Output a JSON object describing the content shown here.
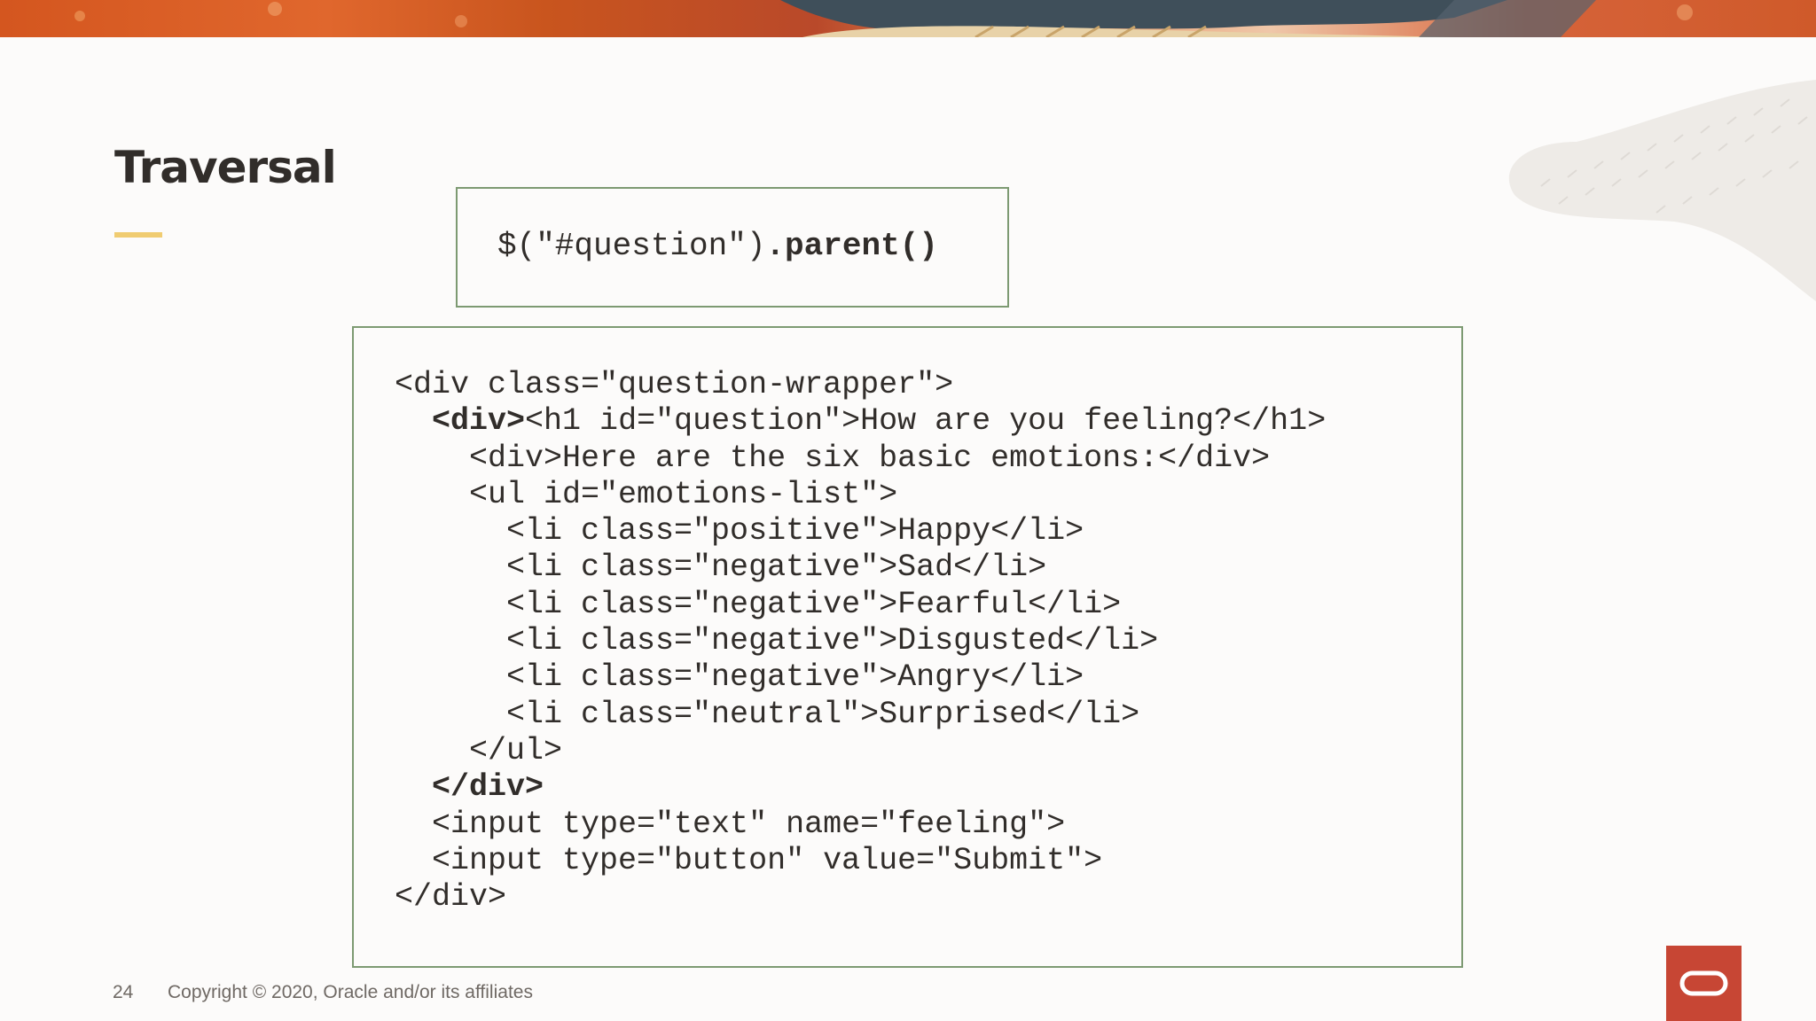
{
  "slide": {
    "title": "Traversal",
    "snippet": {
      "prefix": "$(\"#question\")",
      "method": ".parent()"
    },
    "code": [
      {
        "plain_before": "<div class=\"question-wrapper\">",
        "bold": "",
        "plain_after": ""
      },
      {
        "plain_before": "  ",
        "bold": "<div>",
        "plain_after": "<h1 id=\"question\">How are you feeling?</h1>"
      },
      {
        "plain_before": "    <div>Here are the six basic emotions:</div>",
        "bold": "",
        "plain_after": ""
      },
      {
        "plain_before": "    <ul id=\"emotions-list\">",
        "bold": "",
        "plain_after": ""
      },
      {
        "plain_before": "      <li class=\"positive\">Happy</li>",
        "bold": "",
        "plain_after": ""
      },
      {
        "plain_before": "      <li class=\"negative\">Sad</li>",
        "bold": "",
        "plain_after": ""
      },
      {
        "plain_before": "      <li class=\"negative\">Fearful</li>",
        "bold": "",
        "plain_after": ""
      },
      {
        "plain_before": "      <li class=\"negative\">Disgusted</li>",
        "bold": "",
        "plain_after": ""
      },
      {
        "plain_before": "      <li class=\"negative\">Angry</li>",
        "bold": "",
        "plain_after": ""
      },
      {
        "plain_before": "      <li class=\"neutral\">Surprised</li>",
        "bold": "",
        "plain_after": ""
      },
      {
        "plain_before": "    </ul>",
        "bold": "",
        "plain_after": ""
      },
      {
        "plain_before": "  ",
        "bold": "</div>",
        "plain_after": ""
      },
      {
        "plain_before": "  <input type=\"text\" name=\"feeling\">",
        "bold": "",
        "plain_after": ""
      },
      {
        "plain_before": "  <input type=\"button\" value=\"Submit\">",
        "bold": "",
        "plain_after": ""
      },
      {
        "plain_before": "</div>",
        "bold": "",
        "plain_after": ""
      }
    ]
  },
  "footer": {
    "page_number": "24",
    "copyright": "Copyright © 2020, Oracle and/or its affiliates"
  },
  "colors": {
    "accent_yellow": "#f0cc71",
    "box_border": "#7d9a72",
    "oracle_red": "#c74634",
    "text": "#312d2a"
  },
  "icons": {
    "logo": "oracle-logo-icon"
  }
}
